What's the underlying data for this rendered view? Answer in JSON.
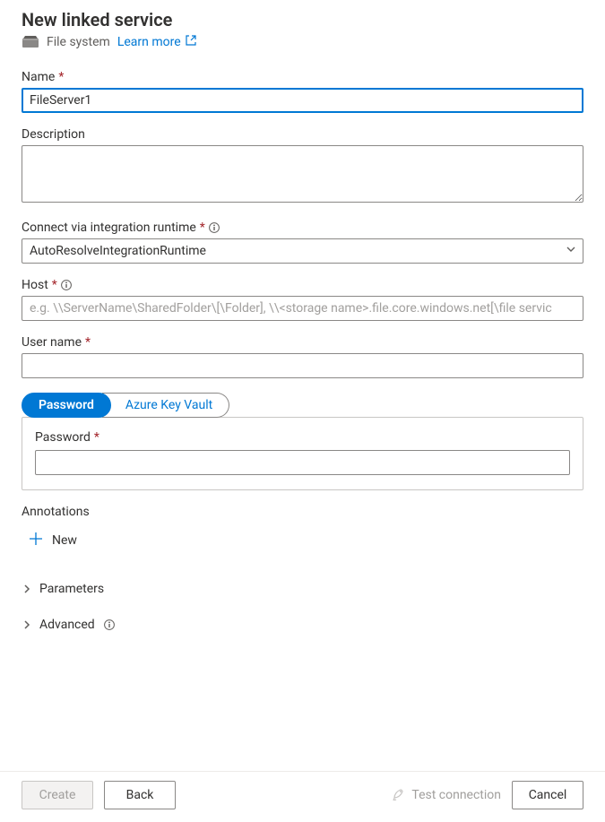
{
  "header": {
    "title": "New linked service",
    "subtitle_type": "File system",
    "learn_more": "Learn more"
  },
  "form": {
    "name": {
      "label": "Name",
      "required": true,
      "value": "FileServer1"
    },
    "description": {
      "label": "Description",
      "value": ""
    },
    "runtime": {
      "label": "Connect via integration runtime",
      "required": true,
      "value": "AutoResolveIntegrationRuntime"
    },
    "host": {
      "label": "Host",
      "required": true,
      "value": "",
      "placeholder": "e.g. \\\\ServerName\\SharedFolder\\[\\Folder], \\\\<storage name>.file.core.windows.net[\\file servic"
    },
    "username": {
      "label": "User name",
      "required": true,
      "value": ""
    },
    "cred_toggle": {
      "password": "Password",
      "akv": "Azure Key Vault"
    },
    "password": {
      "label": "Password",
      "required": true,
      "value": ""
    }
  },
  "annotations": {
    "heading": "Annotations",
    "add_new": "New"
  },
  "sections": {
    "parameters": "Parameters",
    "advanced": "Advanced"
  },
  "footer": {
    "create": "Create",
    "back": "Back",
    "test": "Test connection",
    "cancel": "Cancel"
  }
}
